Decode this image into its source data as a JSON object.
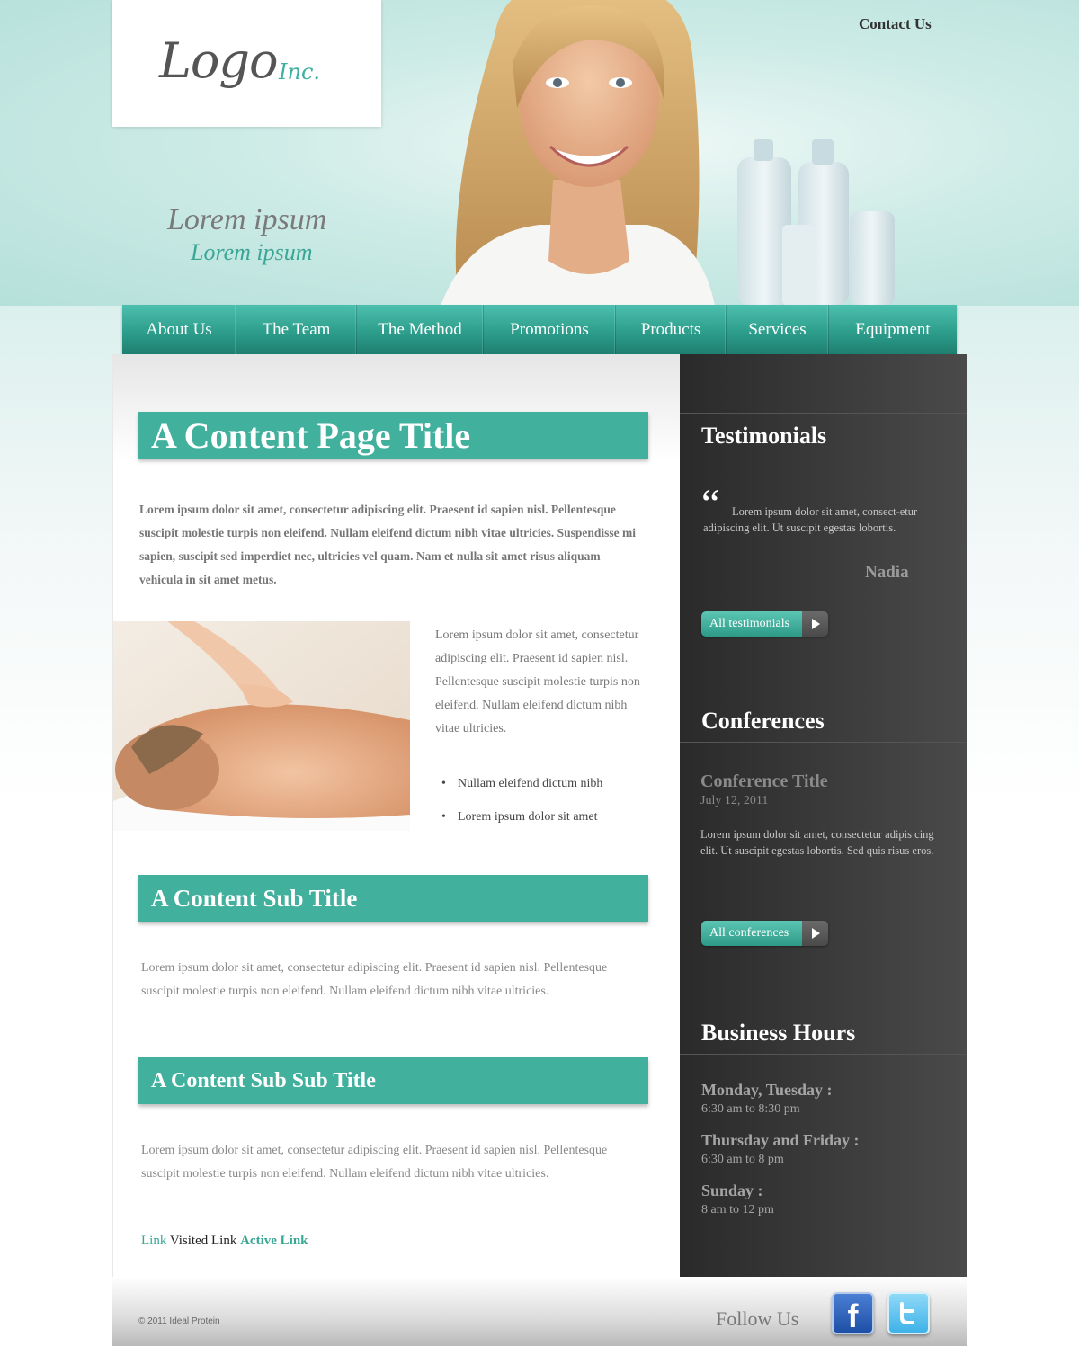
{
  "header": {
    "logo_main": "Logo",
    "logo_suffix": "Inc.",
    "contact_label": "Contact Us",
    "tagline_primary": "Lorem ipsum",
    "tagline_secondary": "Lorem ipsum"
  },
  "nav": {
    "items": [
      {
        "label": "About Us"
      },
      {
        "label": "The Team"
      },
      {
        "label": "The Method"
      },
      {
        "label": "Promotions"
      },
      {
        "label": "Products"
      },
      {
        "label": "Services"
      },
      {
        "label": "Equipment"
      }
    ]
  },
  "main": {
    "page_title": "A Content Page Title",
    "intro": "Lorem ipsum dolor sit amet, consectetur adipiscing elit. Praesent id sapien nisl. Pellentesque suscipit molestie turpis non eleifend. Nullam eleifend dictum nibh vitae ultricies. Suspendisse mi sapien, suscipit sed imperdiet nec, ultricies vel quam. Nam et nulla sit amet risus aliquam vehicula in sit amet metus.",
    "side_text": "Lorem ipsum dolor sit amet, consectetur adipiscing elit. Praesent id sapien nisl. Pellentesque suscipit molestie turpis non eleifend. Nullam eleifend dictum nibh vitae ultricies.",
    "bullets": [
      "Nullam eleifend dictum nibh",
      "Lorem ipsum dolor sit amet"
    ],
    "sub_title": "A Content Sub Title",
    "sub_text": "Lorem ipsum dolor sit amet, consectetur adipiscing elit. Praesent id sapien nisl. Pellentesque suscipit molestie turpis non eleifend. Nullam eleifend dictum nibh vitae ultricies.",
    "sub_sub_title": "A Content Sub Sub Title",
    "sub_sub_text": "Lorem ipsum dolor sit amet, consectetur adipiscing elit. Praesent id sapien nisl. Pellentesque suscipit molestie turpis non eleifend. Nullam eleifend dictum nibh vitae ultricies.",
    "links": {
      "link": "Link",
      "visited": "Visited Link",
      "active": "Active Link"
    }
  },
  "sidebar": {
    "testimonials": {
      "heading": "Testimonials",
      "quote_mark": "“",
      "text": "Lorem ipsum dolor sit amet, consect-etur adipiscing elit. Ut suscipit egestas lobortis.",
      "author": "Nadia",
      "button": "All testimonials"
    },
    "conferences": {
      "heading": "Conferences",
      "title": "Conference Title",
      "date": "July 12, 2011",
      "text": "Lorem ipsum dolor sit amet, consectetur adipis cing elit. Ut suscipit egestas lobortis. Sed quis risus eros.",
      "button": "All conferences"
    },
    "hours": {
      "heading": "Business Hours",
      "entries": [
        {
          "day": "Monday, Tuesday :",
          "time": "6:30 am to 8:30 pm"
        },
        {
          "day": "Thursday and Friday :",
          "time": "6:30 am to 8 pm"
        },
        {
          "day": "Sunday :",
          "time": "8 am to 12 pm"
        }
      ]
    }
  },
  "footer": {
    "copyright": "© 2011 Ideal Protein",
    "follow_label": "Follow Us",
    "social": [
      {
        "name": "facebook-icon",
        "glyph": "f"
      },
      {
        "name": "twitter-icon"
      }
    ]
  },
  "colors": {
    "accent_teal": "#41b09d",
    "sidebar_dark": "#3a3a3a",
    "text_gray": "#777777"
  }
}
